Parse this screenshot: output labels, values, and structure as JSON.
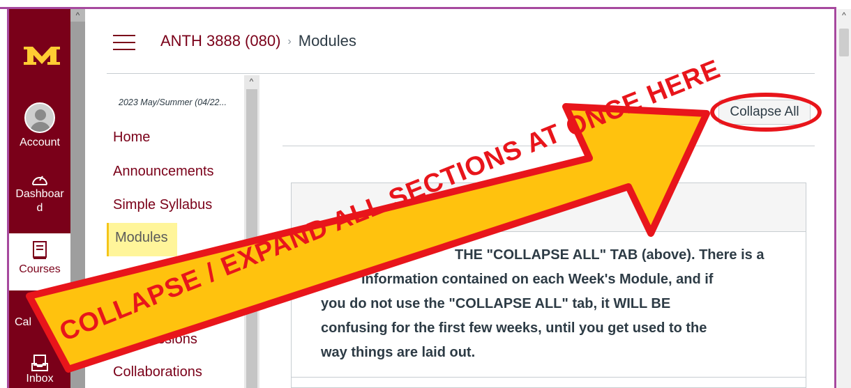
{
  "global_nav": {
    "account_label": "Account",
    "dashboard_label": "Dashboard",
    "courses_label": "Courses",
    "calendar_label": "Cal",
    "inbox_label": "Inbox",
    "brand_color": "#7a0019",
    "logo_text": "M"
  },
  "breadcrumb": {
    "course": "ANTH 3888 (080)",
    "separator": "›",
    "page": "Modules"
  },
  "course_nav": {
    "term": "2023 May/Summer (04/22...",
    "items": [
      "Home",
      "Announcements",
      "Simple Syllabus",
      "Modules",
      "Discussions",
      "Collaborations"
    ],
    "discussions_visible": "ussions",
    "active": "Modules"
  },
  "toolbar": {
    "collapse_all_label": "Collapse All"
  },
  "module": {
    "text_line1": "THE \"COLLAPSE ALL\" TAB (above). There is a",
    "text_line2": "information contained on each Week's Module, and if",
    "text_line3": "you do not use the \"COLLAPSE ALL\" tab, it WILL BE",
    "text_line4": "confusing for the first few weeks, until you get used to the",
    "text_line5": "way things are laid out."
  },
  "annotation": {
    "arrow_text": "COLLAPSE / EXPAND ALL SECTIONS AT ONCE HERE",
    "arrow_fill": "#ffc20e",
    "arrow_stroke": "#e8151b"
  }
}
